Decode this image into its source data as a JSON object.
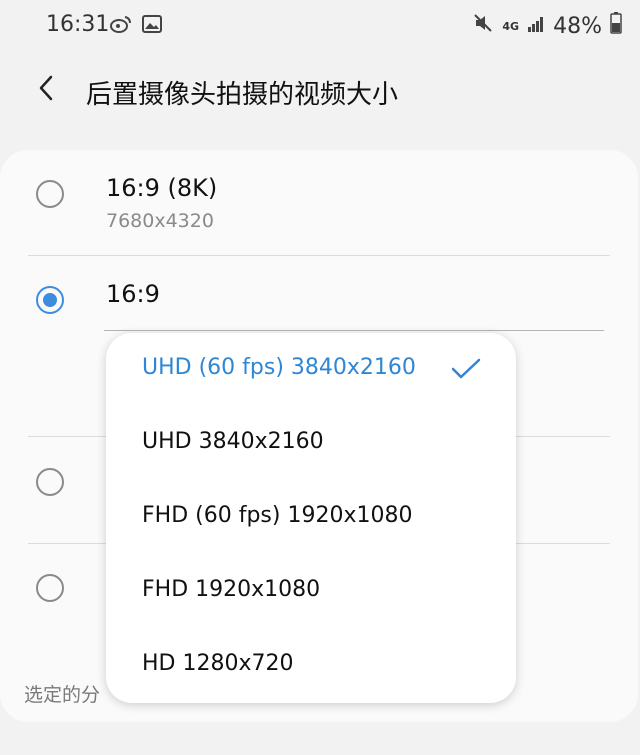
{
  "status_bar": {
    "time": "16:31",
    "battery": "48%",
    "network": "4G",
    "icons": [
      "weibo-icon",
      "image-icon",
      "mute-icon",
      "signal-icon",
      "battery-icon"
    ]
  },
  "header": {
    "title": "后置摄像头拍摄的视频大小",
    "back_icon": "chevron-left-icon"
  },
  "options": [
    {
      "title": "16:9 (8K)",
      "subtitle": "7680x4320",
      "checked": false
    },
    {
      "title": "16:9",
      "subtitle": "",
      "checked": true
    },
    {
      "title": "",
      "subtitle": "",
      "checked": false
    },
    {
      "title": "",
      "subtitle": "",
      "checked": false
    }
  ],
  "footer": {
    "text": "选定的分"
  },
  "dropdown": {
    "items": [
      {
        "label": "UHD (60 fps) 3840x2160",
        "selected": true
      },
      {
        "label": "UHD 3840x2160",
        "selected": false
      },
      {
        "label": "FHD (60 fps) 1920x1080",
        "selected": false
      },
      {
        "label": "FHD 1920x1080",
        "selected": false
      },
      {
        "label": "HD 1280x720",
        "selected": false
      }
    ]
  },
  "colors": {
    "accent": "#3e8ce0",
    "selected_text": "#2f86d4",
    "background": "#f2f2f2",
    "card": "#fafafa"
  }
}
